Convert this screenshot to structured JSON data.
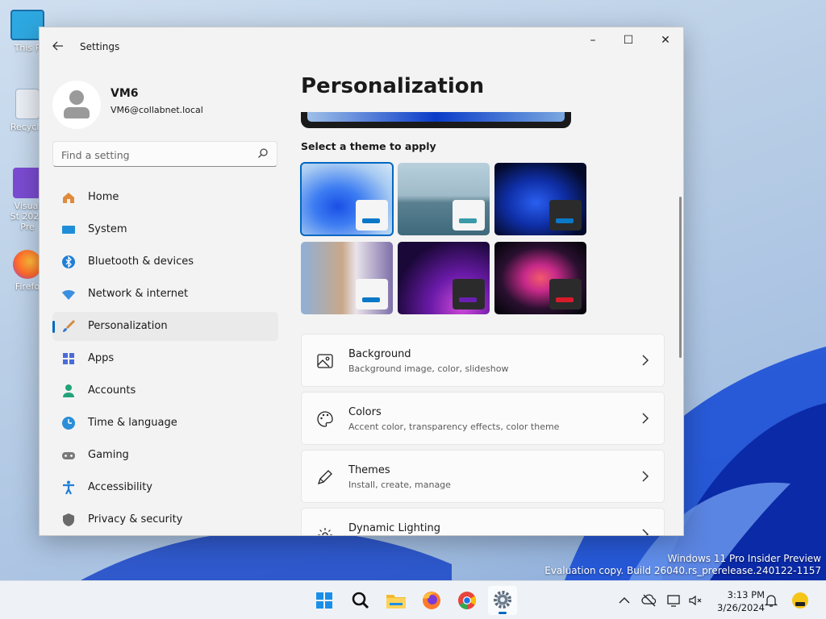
{
  "desktop": {
    "icons": [
      {
        "label": "This P",
        "color": "#2ea8e0"
      },
      {
        "label": "Recycle",
        "color": "#e9eef5"
      },
      {
        "label": "Visual St 2022 Pre",
        "color": "#7a4bd1"
      },
      {
        "label": "Firefo",
        "color": "#ff6a2a"
      }
    ],
    "watermark": {
      "line1": "Windows 11 Pro Insider Preview",
      "line2": "Evaluation copy. Build 26040.rs_prerelease.240122-1157"
    }
  },
  "window": {
    "title": "Settings",
    "controls": {
      "minimize": "–",
      "maximize": "☐",
      "close": "✕"
    },
    "profile": {
      "name": "VM6",
      "email": "VM6@collabnet.local"
    },
    "search": {
      "placeholder": "Find a setting"
    },
    "nav": [
      {
        "label": "Home",
        "icon": "home-icon",
        "color": "#e08a3a",
        "active": false
      },
      {
        "label": "System",
        "icon": "system-icon",
        "color": "#1f8ed8",
        "active": false
      },
      {
        "label": "Bluetooth & devices",
        "icon": "bluetooth-icon",
        "color": "#1f7fd6",
        "active": false
      },
      {
        "label": "Network & internet",
        "icon": "wifi-icon",
        "color": "#3a8fe0",
        "active": false
      },
      {
        "label": "Personalization",
        "icon": "brush-icon",
        "color": "#d08a40",
        "active": true
      },
      {
        "label": "Apps",
        "icon": "apps-icon",
        "color": "#4a6bd8",
        "active": false
      },
      {
        "label": "Accounts",
        "icon": "accounts-icon",
        "color": "#22a37a",
        "active": false
      },
      {
        "label": "Time & language",
        "icon": "globe-icon",
        "color": "#2a8fd8",
        "active": false
      },
      {
        "label": "Gaming",
        "icon": "gamepad-icon",
        "color": "#7a7a7a",
        "active": false
      },
      {
        "label": "Accessibility",
        "icon": "accessibility-icon",
        "color": "#1f7fd6",
        "active": false
      },
      {
        "label": "Privacy & security",
        "icon": "shield-icon",
        "color": "#6a6a6a",
        "active": false
      }
    ],
    "main": {
      "title": "Personalization",
      "theme_section_label": "Select a theme to apply",
      "themes": [
        {
          "name": "windows-light-theme",
          "accent": "#0a78c8",
          "mini": "#f5f5f5",
          "selected": true
        },
        {
          "name": "glow-theme",
          "accent": "#3a9aa8",
          "mini": "#f5f5f5",
          "selected": false
        },
        {
          "name": "windows-dark-theme",
          "accent": "#0a78c8",
          "mini": "#2b2b2b",
          "selected": false
        },
        {
          "name": "spotlight-theme",
          "accent": "#0a78c8",
          "mini": "#f5f5f5",
          "selected": false
        },
        {
          "name": "sunrise-theme",
          "accent": "#6a1fb0",
          "mini": "#2b2b2b",
          "selected": false
        },
        {
          "name": "flow-theme",
          "accent": "#d81b2a",
          "mini": "#2b2b2b",
          "selected": false
        }
      ],
      "cards": [
        {
          "title": "Background",
          "subtitle": "Background image, color, slideshow",
          "icon": "image-icon"
        },
        {
          "title": "Colors",
          "subtitle": "Accent color, transparency effects, color theme",
          "icon": "palette-icon"
        },
        {
          "title": "Themes",
          "subtitle": "Install, create, manage",
          "icon": "pen-icon"
        },
        {
          "title": "Dynamic Lighting",
          "subtitle": "",
          "icon": "lighting-icon"
        }
      ]
    }
  },
  "taskbar": {
    "apps": [
      "start-icon",
      "search-icon",
      "file-explorer-icon",
      "firefox-icon",
      "chrome-icon",
      "settings-icon"
    ],
    "time": "3:13 PM",
    "date": "3/26/2024"
  }
}
